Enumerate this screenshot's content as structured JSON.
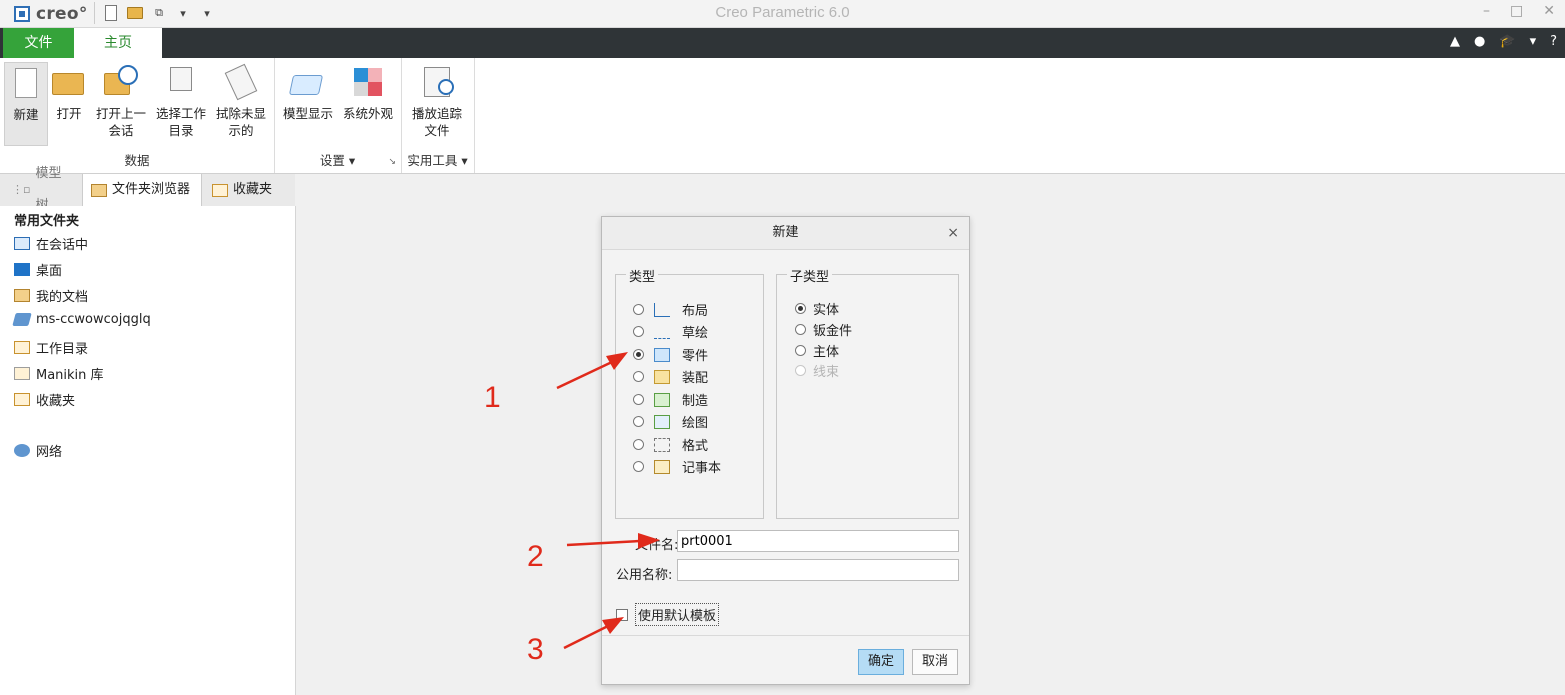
{
  "app": {
    "logo_text": "creo°",
    "window_title": "Creo Parametric 6.0",
    "window_controls": [
      "–",
      "□",
      "✕"
    ]
  },
  "ribbon": {
    "tabs": [
      {
        "label": "文件",
        "color": "#35a33a"
      },
      {
        "label": "主页",
        "color": "#2a8a2e"
      }
    ],
    "right_icons": [
      "▲",
      "●",
      "🎓",
      "▾",
      "?"
    ],
    "groups": {
      "data": {
        "label": "数据",
        "buttons": [
          "新建",
          "打开",
          "打开上一\n会话",
          "选择工作\n目录",
          "拭除未显\n示的"
        ]
      },
      "settings": {
        "label": "设置",
        "dropdown": "▾",
        "buttons": [
          "模型显示",
          "系统外观"
        ]
      },
      "utilities": {
        "label": "实用工具",
        "dropdown": "▾",
        "buttons": [
          "播放追踪\n文件"
        ]
      }
    }
  },
  "left_panel": {
    "tabs": [
      "模型树",
      "文件夹浏览器",
      "收藏夹"
    ],
    "section_title": "常用文件夹",
    "items": [
      "在会话中",
      "桌面",
      "我的文档",
      "ms-ccwowcojqglq",
      "工作目录",
      "Manikin 库",
      "收藏夹"
    ],
    "network": "网络"
  },
  "dialog": {
    "title": "新建",
    "close": "×",
    "type_legend": "类型",
    "types": [
      {
        "label": "布局",
        "selected": false,
        "icon": "layout-icon"
      },
      {
        "label": "草绘",
        "selected": false,
        "icon": "sketch-icon"
      },
      {
        "label": "零件",
        "selected": true,
        "icon": "part-icon"
      },
      {
        "label": "装配",
        "selected": false,
        "icon": "assembly-icon"
      },
      {
        "label": "制造",
        "selected": false,
        "icon": "manufacturing-icon"
      },
      {
        "label": "绘图",
        "selected": false,
        "icon": "drawing-icon"
      },
      {
        "label": "格式",
        "selected": false,
        "icon": "format-icon"
      },
      {
        "label": "记事本",
        "selected": false,
        "icon": "notebook-icon"
      }
    ],
    "subtype_legend": "子类型",
    "subtypes": [
      {
        "label": "实体",
        "selected": true,
        "disabled": false
      },
      {
        "label": "钣金件",
        "selected": false,
        "disabled": false
      },
      {
        "label": "主体",
        "selected": false,
        "disabled": false
      },
      {
        "label": "线束",
        "selected": false,
        "disabled": true
      }
    ],
    "filename_label": "文件名:",
    "filename_value": "prt0001",
    "common_name_label": "公用名称:",
    "common_name_value": "",
    "use_default_template_label": "使用默认模板",
    "use_default_template_checked": false,
    "ok_label": "确定",
    "cancel_label": "取消"
  },
  "annotations": {
    "labels": [
      "1",
      "2",
      "3"
    ],
    "color": "#e02a1b"
  }
}
